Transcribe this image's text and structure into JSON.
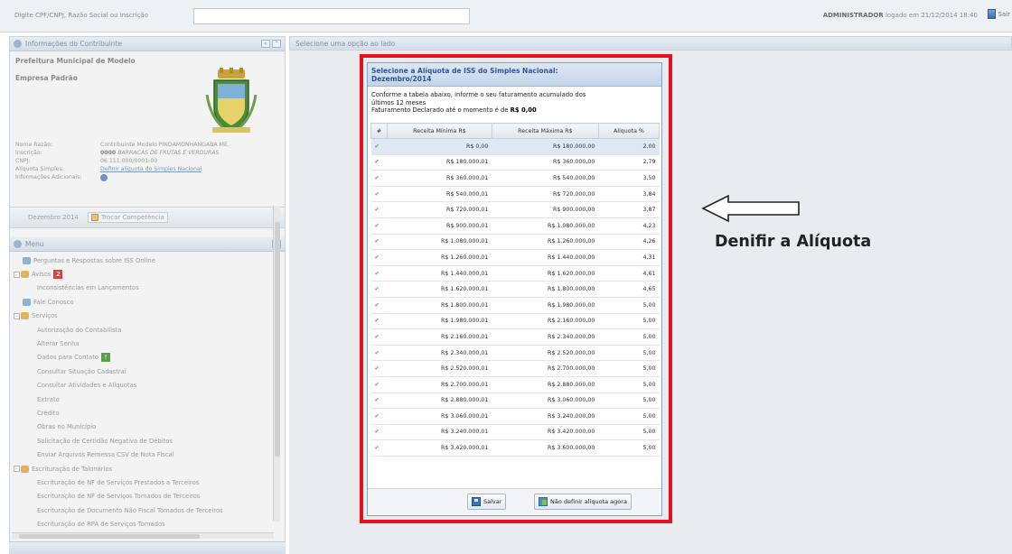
{
  "topbar": {
    "search_label": "Digite CPF/CNPJ, Razão Social ou Inscrição",
    "search_value": "",
    "user_name": "ADMINISTRADOR",
    "user_status": "logado em 21/12/2014 18:40",
    "exit_label": "Sair"
  },
  "left_panel": {
    "info_header": "Informações do Contribuinte",
    "prefeitura": "Prefeitura Municipal de Modelo",
    "empresa": "Empresa Padrão",
    "fields": [
      {
        "key": "Nome Razão:",
        "value": "Contribuinte Modelo PINDAMONHANGABA ME."
      },
      {
        "key": "Inscrição:",
        "value_bold": "0000",
        "value": "BARRACAS DE FRUTAS E VERDURAS"
      },
      {
        "key": "CNPJ:",
        "value": "06.111.000/0001-00"
      },
      {
        "key": "Alíquota Simples:",
        "value": "Definir alíquota do Simples Nacional"
      },
      {
        "key": "Informações Adicionais:",
        "value": ""
      }
    ],
    "competencia": "Dezembro 2014",
    "trocar_label": "Trocar Competência",
    "menu_header": "Menu",
    "menu_items": [
      {
        "label": "Perguntas e Respostas sobre ISS Online",
        "indent": 1
      },
      {
        "label": "Avisos",
        "indent": 0,
        "expander": "-",
        "badge": "2"
      },
      {
        "label": "Inconsistências em Lançamentos",
        "indent": 2
      },
      {
        "label": "Fale Conosco",
        "indent": 1
      },
      {
        "label": "Serviços",
        "indent": 0,
        "expander": "-"
      },
      {
        "label": "Autorização do Contabilista",
        "indent": 2
      },
      {
        "label": "Alterar Senha",
        "indent": 2
      },
      {
        "label": "Dados para Contato",
        "indent": 2,
        "badge_green": "!"
      },
      {
        "label": "Consultar Situação Cadastral",
        "indent": 2
      },
      {
        "label": "Consultar Atividades e Alíquotas",
        "indent": 2
      },
      {
        "label": "Extrato",
        "indent": 2
      },
      {
        "label": "Crédito",
        "indent": 2
      },
      {
        "label": "Obras no Município",
        "indent": 2
      },
      {
        "label": "Solicitação de Certidão Negativa de Débitos",
        "indent": 2
      },
      {
        "label": "Enviar Arquivos Remessa CSV de Nota Fiscal",
        "indent": 2
      },
      {
        "label": "Escrituração de Talonários",
        "indent": 0,
        "expander": "-"
      },
      {
        "label": "Escrituração de NF de Serviços Prestados a Terceiros",
        "indent": 2
      },
      {
        "label": "Escrituração de NF de Serviços Tomados de Terceiros",
        "indent": 2
      },
      {
        "label": "Escrituração de Documento Não Fiscal Tomados de Terceiros",
        "indent": 2
      },
      {
        "label": "Escrituração de RPA de Serviços Tomados",
        "indent": 2
      }
    ]
  },
  "content": {
    "header": "Selecione uma opção ao lado"
  },
  "dialog": {
    "title_line1": "Selecione a Alíquota de ISS do Simples Nacional:",
    "title_line2": "Dezembro/2014",
    "desc_line1": "Conforme a tabela abaixo, informe o seu faturamento acumulado dos",
    "desc_line2": "últimos 12 meses",
    "desc_line3": "Faturamento Declarado até o momento é de",
    "desc_amount": "R$ 0,00",
    "columns": [
      "#",
      "Receita Mínima R$",
      "Receita Máxima R$",
      "Alíquota %"
    ],
    "rows": [
      [
        "R$ 0,00",
        "R$ 180.000,00",
        "2,00"
      ],
      [
        "R$ 180.000,01",
        "R$ 360.000,00",
        "2,79"
      ],
      [
        "R$ 360.000,01",
        "R$ 540.000,00",
        "3,50"
      ],
      [
        "R$ 540.000,01",
        "R$ 720.000,00",
        "3,84"
      ],
      [
        "R$ 720.000,01",
        "R$ 900.000,00",
        "3,87"
      ],
      [
        "R$ 900.000,01",
        "R$ 1.080.000,00",
        "4,23"
      ],
      [
        "R$ 1.080.000,01",
        "R$ 1.260.000,00",
        "4,26"
      ],
      [
        "R$ 1.260.000,01",
        "R$ 1.440.000,00",
        "4,31"
      ],
      [
        "R$ 1.440.000,01",
        "R$ 1.620.000,00",
        "4,61"
      ],
      [
        "R$ 1.620.000,01",
        "R$ 1.800.000,00",
        "4,65"
      ],
      [
        "R$ 1.800.000,01",
        "R$ 1.980.000,00",
        "5,00"
      ],
      [
        "R$ 1.980.000,01",
        "R$ 2.160.000,00",
        "5,00"
      ],
      [
        "R$ 2.160.000,01",
        "R$ 2.340.000,00",
        "5,00"
      ],
      [
        "R$ 2.340.000,01",
        "R$ 2.520.000,00",
        "5,00"
      ],
      [
        "R$ 2.520.000,01",
        "R$ 2.700.000,00",
        "5,00"
      ],
      [
        "R$ 2.700.000,01",
        "R$ 2.880.000,00",
        "5,00"
      ],
      [
        "R$ 2.880.000,01",
        "R$ 3.060.000,00",
        "5,00"
      ],
      [
        "R$ 3.060.000,01",
        "R$ 3.240.000,00",
        "5,00"
      ],
      [
        "R$ 3.240.000,01",
        "R$ 3.420.000,00",
        "5,00"
      ],
      [
        "R$ 3.420.000,01",
        "R$ 3.600.000,00",
        "5,00"
      ]
    ],
    "check_glyph": "✔",
    "save_label": "Salvar",
    "cancel_label": "Não definir alíquota agora"
  },
  "annotation": {
    "text": "Denifir a Alíquota"
  },
  "colors": {
    "highlight_border": "#e8101c",
    "dialog_title": "#2e5597",
    "check": "#4da23d",
    "badge_red": "#e0403a"
  }
}
